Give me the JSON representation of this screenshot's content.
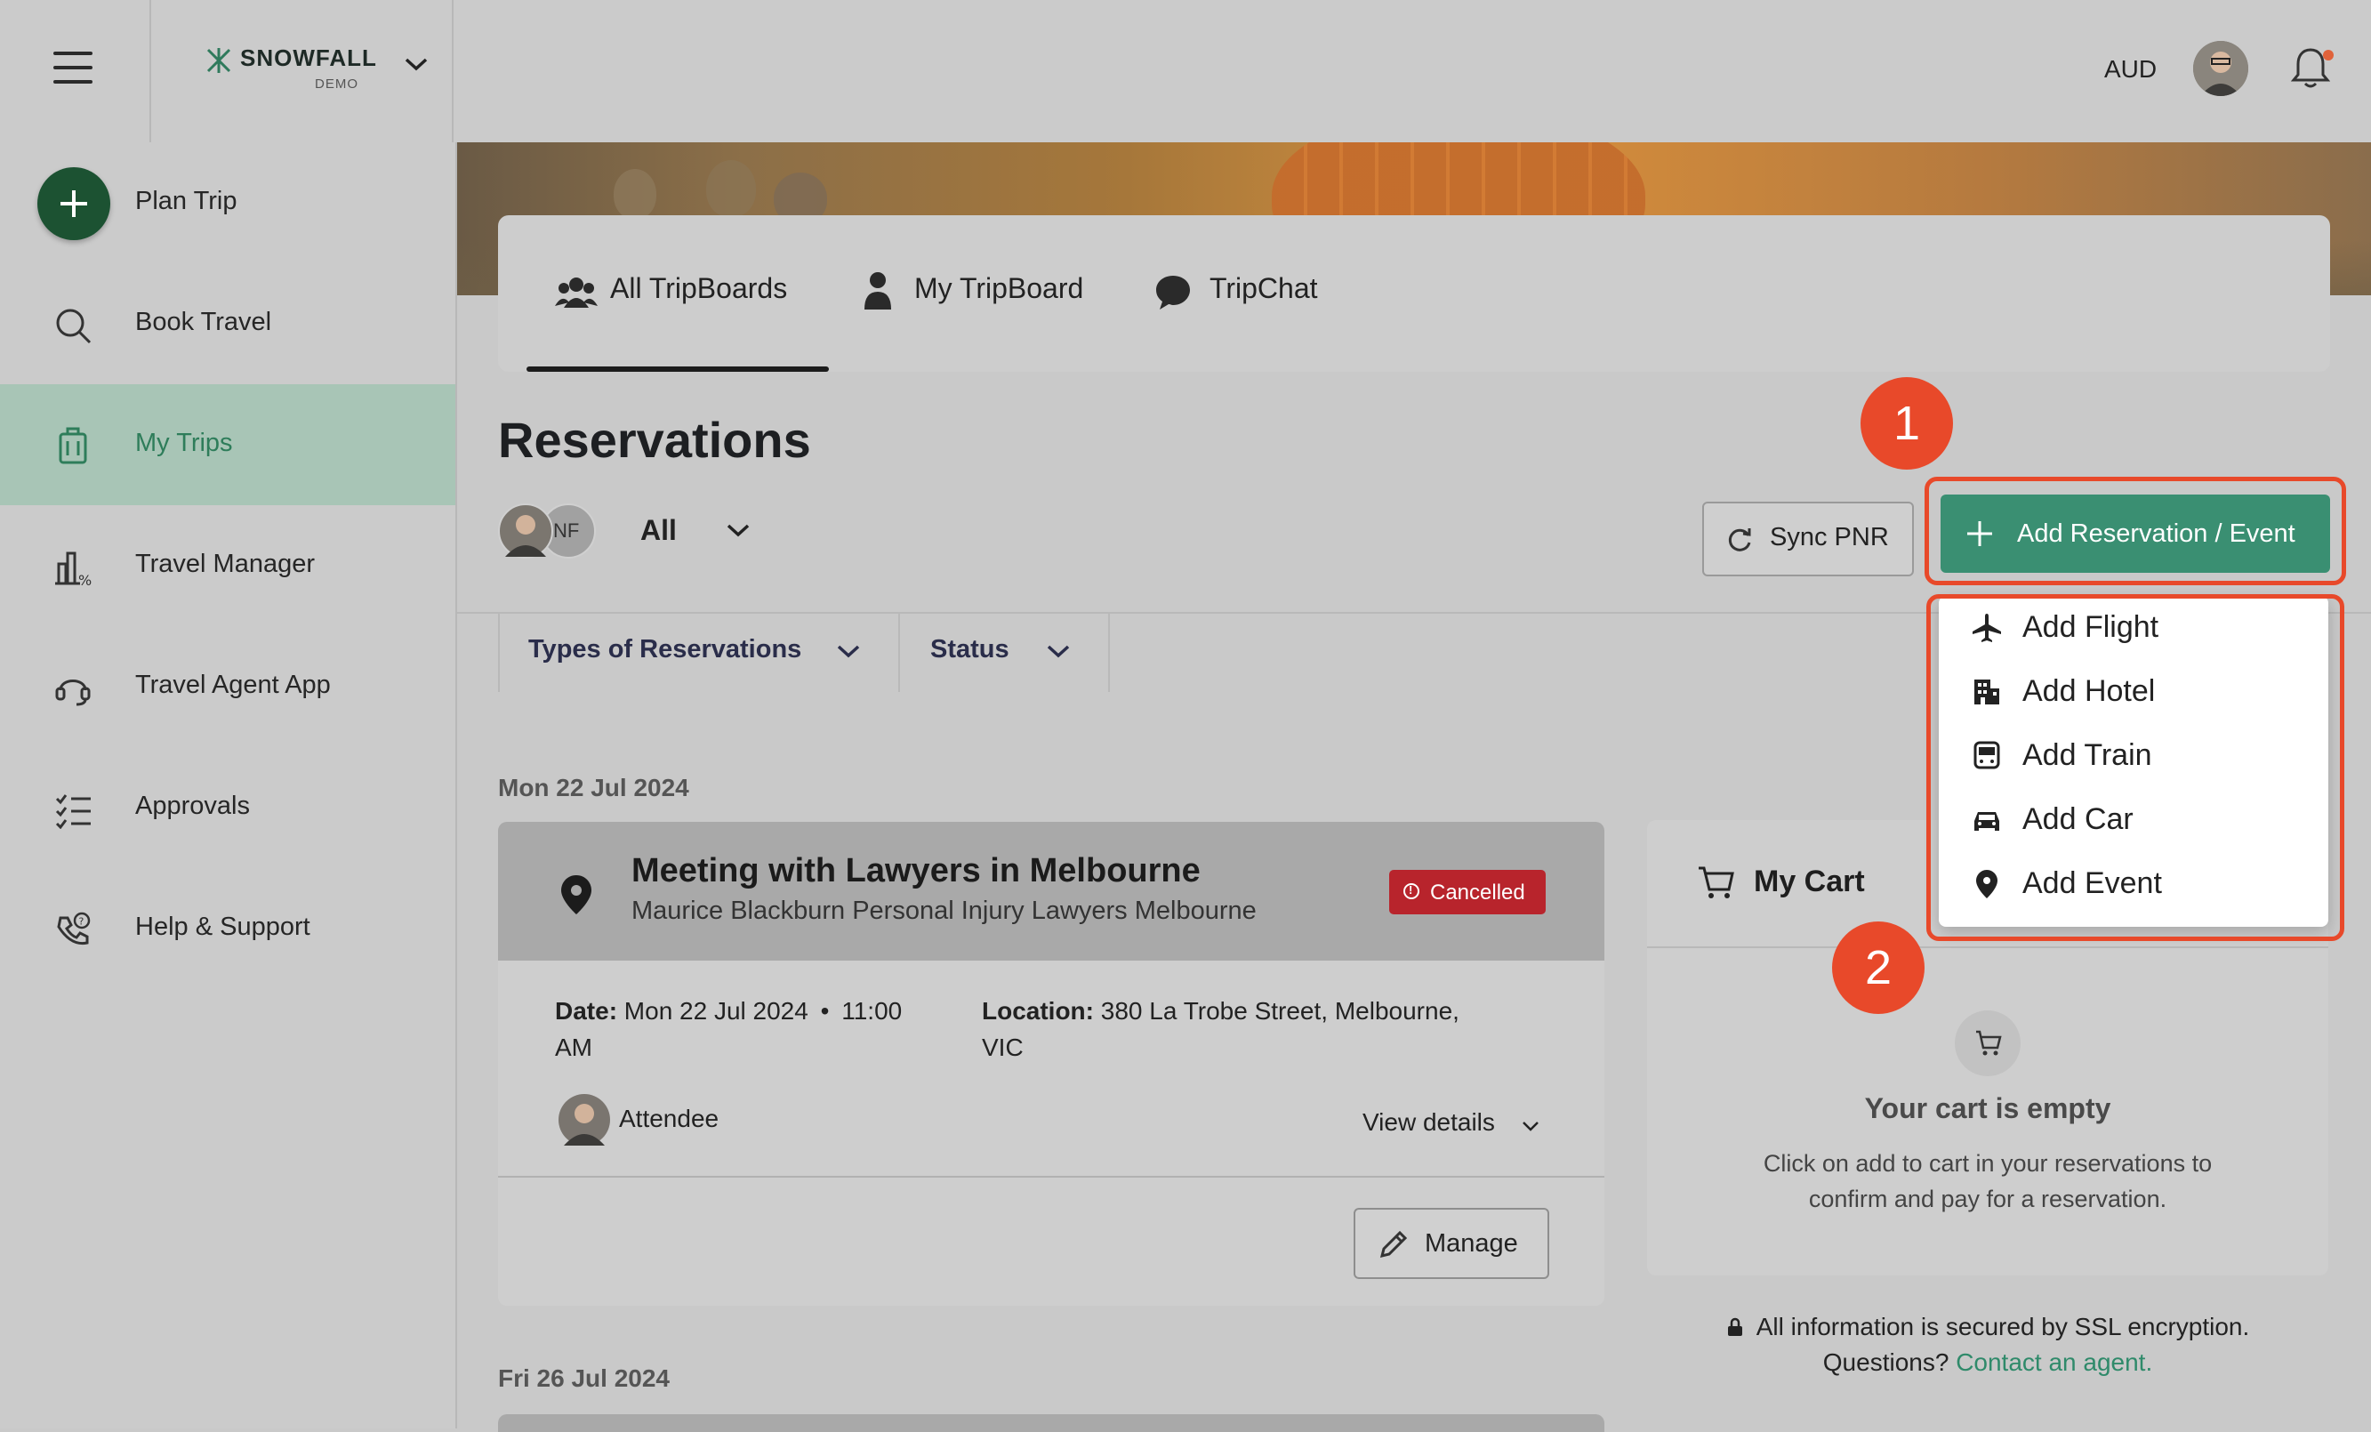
{
  "header": {
    "brand": "SNOWFALL",
    "brand_sub": "DEMO",
    "currency": "AUD"
  },
  "sidebar": {
    "items": [
      {
        "label": "Plan Trip",
        "icon": "plus-circle-icon"
      },
      {
        "label": "Book Travel",
        "icon": "search-icon"
      },
      {
        "label": "My Trips",
        "icon": "luggage-icon",
        "active": true
      },
      {
        "label": "Travel Manager",
        "icon": "buildings-chart-icon"
      },
      {
        "label": "Travel Agent App",
        "icon": "headset-icon"
      },
      {
        "label": "Approvals",
        "icon": "checklist-icon"
      },
      {
        "label": "Help & Support",
        "icon": "phone-help-icon"
      }
    ]
  },
  "tabs": [
    {
      "label": "All TripBoards",
      "icon": "people-icon",
      "active": true
    },
    {
      "label": "My TripBoard",
      "icon": "person-icon"
    },
    {
      "label": "TripChat",
      "icon": "chat-bubble-icon"
    }
  ],
  "main": {
    "title": "Reservations",
    "traveler_initials": "NF",
    "traveler_filter": "All",
    "sync_pnr_label": "Sync PNR",
    "add_reservation_label": "Add Reservation / Event",
    "filters": [
      {
        "label": "Types of Reservations"
      },
      {
        "label": "Status"
      }
    ]
  },
  "dropdown": {
    "items": [
      {
        "label": "Add Flight",
        "icon": "plane-icon"
      },
      {
        "label": "Add Hotel",
        "icon": "hotel-icon"
      },
      {
        "label": "Add Train",
        "icon": "train-icon"
      },
      {
        "label": "Add Car",
        "icon": "car-icon"
      },
      {
        "label": "Add Event",
        "icon": "location-pin-icon"
      }
    ]
  },
  "reservations": [
    {
      "date_header": "Mon 22 Jul 2024",
      "title": "Meeting with Lawyers in Melbourne",
      "subtitle": "Maurice Blackburn Personal Injury Lawyers Melbourne",
      "status": "Cancelled",
      "date_label": "Date:",
      "date_value": "Mon 22 Jul 2024",
      "time_value": "11:00",
      "time_suffix": "AM",
      "location_label": "Location:",
      "location_value": "380 La Trobe Street, Melbourne,",
      "location_value2": "VIC",
      "attendee_label": "Attendee",
      "view_details": "View details",
      "manage": "Manage"
    },
    {
      "date_header": "Fri 26 Jul 2024"
    }
  ],
  "cart": {
    "title": "My Cart",
    "empty_title": "Your cart is empty",
    "empty_text": "Click on add to cart in your reservations to confirm and pay for a reservation."
  },
  "footer": {
    "ssl_text": "All information is secured by SSL encryption.",
    "questions": "Questions?",
    "contact_link": "Contact an agent."
  },
  "annotations": [
    "1",
    "2"
  ],
  "colors": {
    "accent": "#3a8f72",
    "annotation": "#e8492a",
    "cancelled": "#b8242c",
    "active_nav": "#a8c5b6"
  }
}
